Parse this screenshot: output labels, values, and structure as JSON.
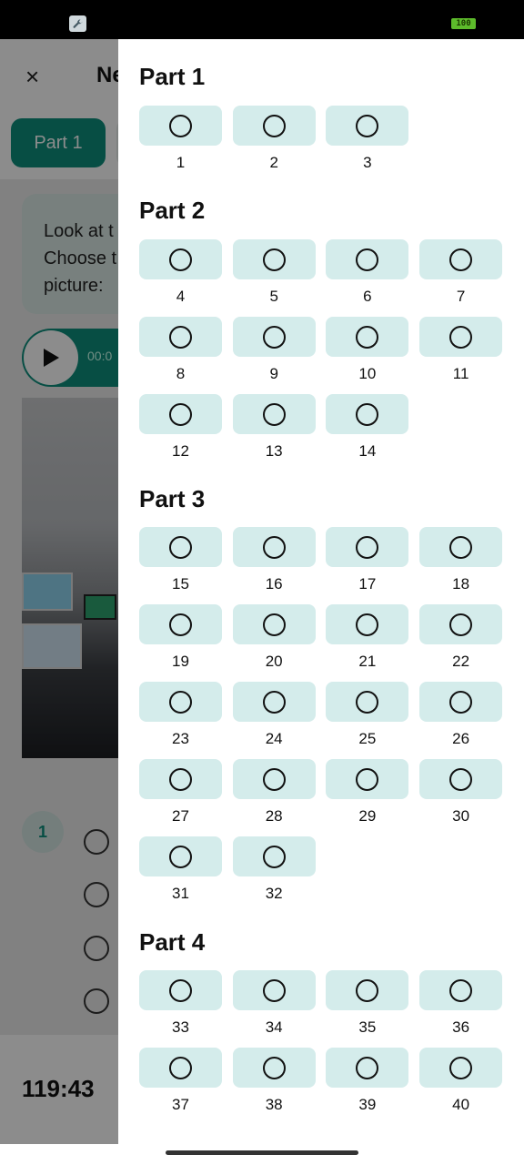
{
  "status_bar": {
    "battery": "100",
    "icons": [
      "wrench-icon"
    ]
  },
  "background": {
    "title": "Ne",
    "tab_active": "Part 1",
    "instruction": "Look at t\nChoose t\npicture:",
    "audio_time": "00:0",
    "question_number": "1",
    "timer": "119:43"
  },
  "drawer": {
    "parts": [
      {
        "title": "Part 1",
        "questions": [
          "1",
          "2",
          "3"
        ]
      },
      {
        "title": "Part 2",
        "questions": [
          "4",
          "5",
          "6",
          "7",
          "8",
          "9",
          "10",
          "11",
          "12",
          "13",
          "14"
        ]
      },
      {
        "title": "Part 3",
        "questions": [
          "15",
          "16",
          "17",
          "18",
          "19",
          "20",
          "21",
          "22",
          "23",
          "24",
          "25",
          "26",
          "27",
          "28",
          "29",
          "30",
          "31",
          "32"
        ]
      },
      {
        "title": "Part 4",
        "questions": [
          "33",
          "34",
          "35",
          "36",
          "37",
          "38",
          "39",
          "40"
        ]
      }
    ]
  },
  "colors": {
    "accent": "#0d8f7d",
    "chip": "#d4eceb",
    "scrim": "rgba(0,0,0,0.45)"
  }
}
